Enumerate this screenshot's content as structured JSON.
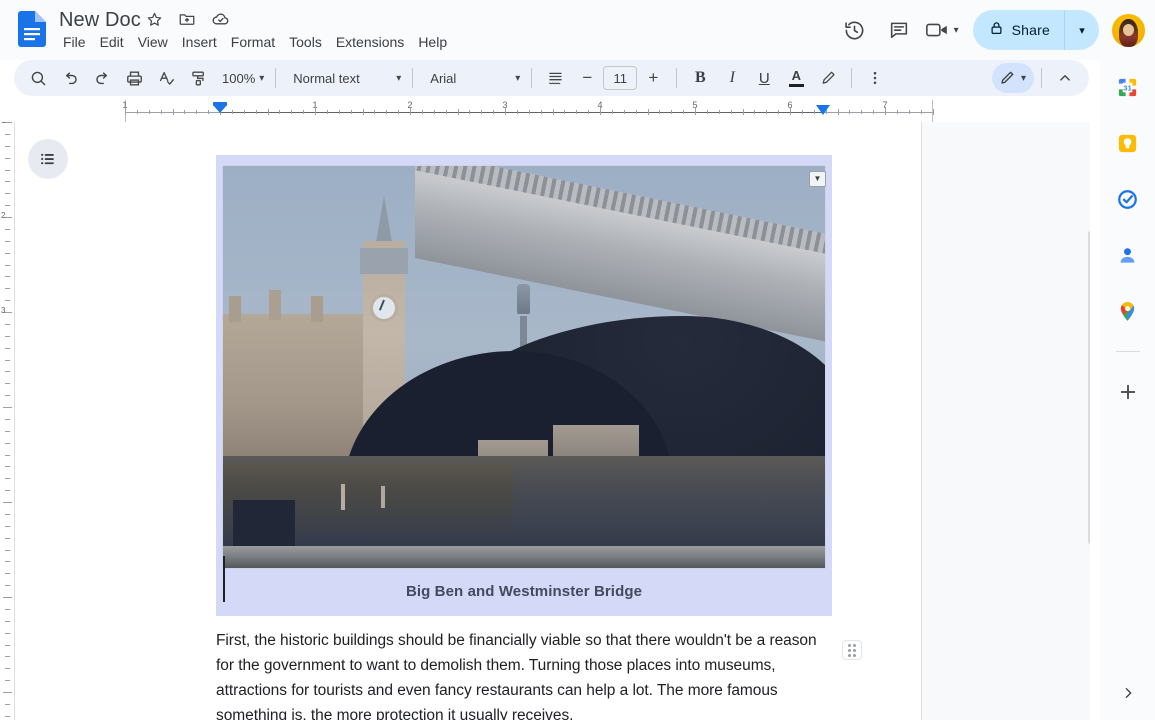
{
  "app": {
    "name": "Google Docs"
  },
  "titlebar": {
    "doc_title": "New Doc",
    "icons": [
      {
        "name": "star-icon",
        "label": "Star"
      },
      {
        "name": "move-to-folder-icon",
        "label": "Move"
      },
      {
        "name": "saved-to-drive-icon",
        "label": "Saved to Drive"
      }
    ],
    "menus": [
      "File",
      "Edit",
      "View",
      "Insert",
      "Format",
      "Tools",
      "Extensions",
      "Help"
    ],
    "right_actions": [
      {
        "name": "version-history-icon",
        "label": "Version history"
      },
      {
        "name": "comment-history-icon",
        "label": "Open comment history"
      },
      {
        "name": "meet-camera-icon",
        "label": "Join a call"
      }
    ],
    "share": {
      "label": "Share",
      "lock_icon": "lock-icon",
      "caret": "▾"
    },
    "avatar_label": "Google Account"
  },
  "toolbar": {
    "search_icon": "search-icon",
    "undo_icon": "undo-icon",
    "redo_icon": "redo-icon",
    "print_icon": "print-icon",
    "spellcheck_icon": "spellcheck-icon",
    "paint_format_icon": "paint-format-icon",
    "zoom_value": "100%",
    "paragraph_style": "Normal text",
    "font_family": "Arial",
    "font_size": "11",
    "decrease_font": "−",
    "increase_font": "+",
    "bold": "B",
    "italic": "I",
    "underline": "U",
    "text_color": "A",
    "highlight_icon": "highlight-pen-icon",
    "more_options_icon": "more-vertical-icon",
    "mode_icon": "edit-pencil-icon",
    "mode_caret": "▾",
    "collapse_icon": "chevron-up-icon",
    "line_spacing_icon": "line-spacing-icon"
  },
  "ruler": {
    "numbers": [
      "1",
      "1",
      "2",
      "3",
      "4",
      "5",
      "6",
      "7"
    ],
    "left_indent_marker": "left-indent-marker",
    "right_indent_marker": "right-indent-marker"
  },
  "document": {
    "outline_button": "show-outline-button",
    "image": {
      "alt": "Big Ben and Westminster Bridge photograph",
      "caret": "▼",
      "selected": true
    },
    "caption": "Big Ben and Westminster Bridge",
    "paragraph": "First, the historic buildings should be financially viable so that there wouldn't be a reason for the government to want to demolish them. Turning those places into museums, attractions for tourists and even fancy restaurants can help a lot. The more famous something is, the more protection it usually receives.",
    "drag_handle": "drag-handle"
  },
  "sidebar": {
    "items": [
      {
        "name": "google-calendar-icon",
        "label": "Calendar",
        "date": "31"
      },
      {
        "name": "google-keep-icon",
        "label": "Keep"
      },
      {
        "name": "google-tasks-icon",
        "label": "Tasks"
      },
      {
        "name": "google-contacts-icon",
        "label": "Contacts"
      },
      {
        "name": "google-maps-icon",
        "label": "Maps"
      }
    ],
    "add_ons_label": "+",
    "expand_label": "›"
  },
  "colors": {
    "accent_blue": "#1a73e8",
    "toolbar_bg": "#edf2fa",
    "share_bg": "#c2e7ff",
    "selection": "#d3d9f7",
    "page_bg": "#f8f9fa"
  }
}
